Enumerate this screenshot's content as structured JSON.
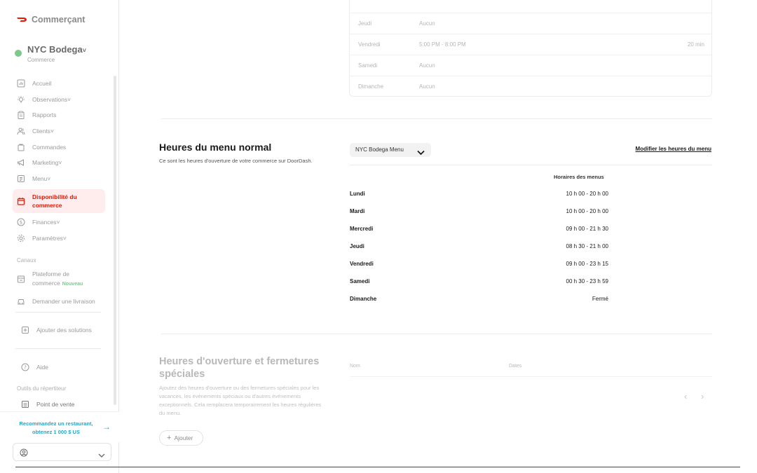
{
  "brand": {
    "name": "Commerçant"
  },
  "store": {
    "name": "NYC Bodega",
    "caret": "˅",
    "type": "Commerce"
  },
  "nav": {
    "items": [
      {
        "label": "Accueil"
      },
      {
        "label": "Observations˅"
      },
      {
        "label": "Rapports"
      },
      {
        "label": "Clients˅"
      },
      {
        "label": "Commandes"
      },
      {
        "label": "Marketing˅"
      },
      {
        "label": "Menu˅"
      },
      {
        "label": "Disponibilité du commerce",
        "active": true
      },
      {
        "label": "Finances˅"
      },
      {
        "label": "Paramètres˅"
      }
    ],
    "channels_label": "Canaux",
    "platform_label": "Plateforme de commerce",
    "platform_badge": "Nouveau",
    "delivery_label": "Demander une livraison",
    "add_solutions_label": "Ajouter des solutions",
    "help_label": "Aide",
    "tools_label": "Outils du répertiteur",
    "pos_label": "Point de vente"
  },
  "referral": {
    "text": "Recommandez un restaurant, obtenez 1 000 $ US"
  },
  "top_table": {
    "rows": [
      {
        "day": "Jeudi",
        "hours": "Aucun",
        "duration": ""
      },
      {
        "day": "Vendredi",
        "hours": "5:00 PM - 8:00 PM",
        "duration": "20 min"
      },
      {
        "day": "Samedi",
        "hours": "Aucun",
        "duration": ""
      },
      {
        "day": "Dimanche",
        "hours": "Aucun",
        "duration": ""
      }
    ]
  },
  "regular_hours": {
    "title": "Heures du menu normal",
    "description": "Ce sont les heures d'ouverture de votre commerce sur DoorDash.",
    "menu_select": "NYC Bodega Menu",
    "edit_link": "Modifier les heures du menu",
    "column_header": "Horaires des menus",
    "rows": [
      {
        "day": "Lundi",
        "hours": "10 h 00 - 20 h 00"
      },
      {
        "day": "Mardi",
        "hours": "10 h 00 - 20 h 00"
      },
      {
        "day": "Mercredi",
        "hours": "09 h 00 - 21 h 30"
      },
      {
        "day": "Jeudi",
        "hours": "08 h 30 - 21 h 00"
      },
      {
        "day": "Vendredi",
        "hours": "09 h 00 - 23 h 15"
      },
      {
        "day": "Samedi",
        "hours": "00 h 30 - 23 h 59"
      },
      {
        "day": "Dimanche",
        "hours": "Fermé"
      }
    ]
  },
  "special_hours": {
    "title": "Heures d'ouverture et fermetures spéciales",
    "description": "Ajoutez des heures d'ouverture ou des fermetures spéciales pour les vacances, les événements spéciaux ou d'autres événements exceptionnels. Cela remplacera temporairement les heures régulières du menu.",
    "add_button": "Ajouter",
    "col_name": "Nom",
    "col_dates": "Dates",
    "prev": "‹",
    "next": "›"
  },
  "colors": {
    "accent": "#eb1700",
    "active_bg": "#ffecec",
    "store_dot": "#7dc88b",
    "link": "#2aa3c6"
  }
}
